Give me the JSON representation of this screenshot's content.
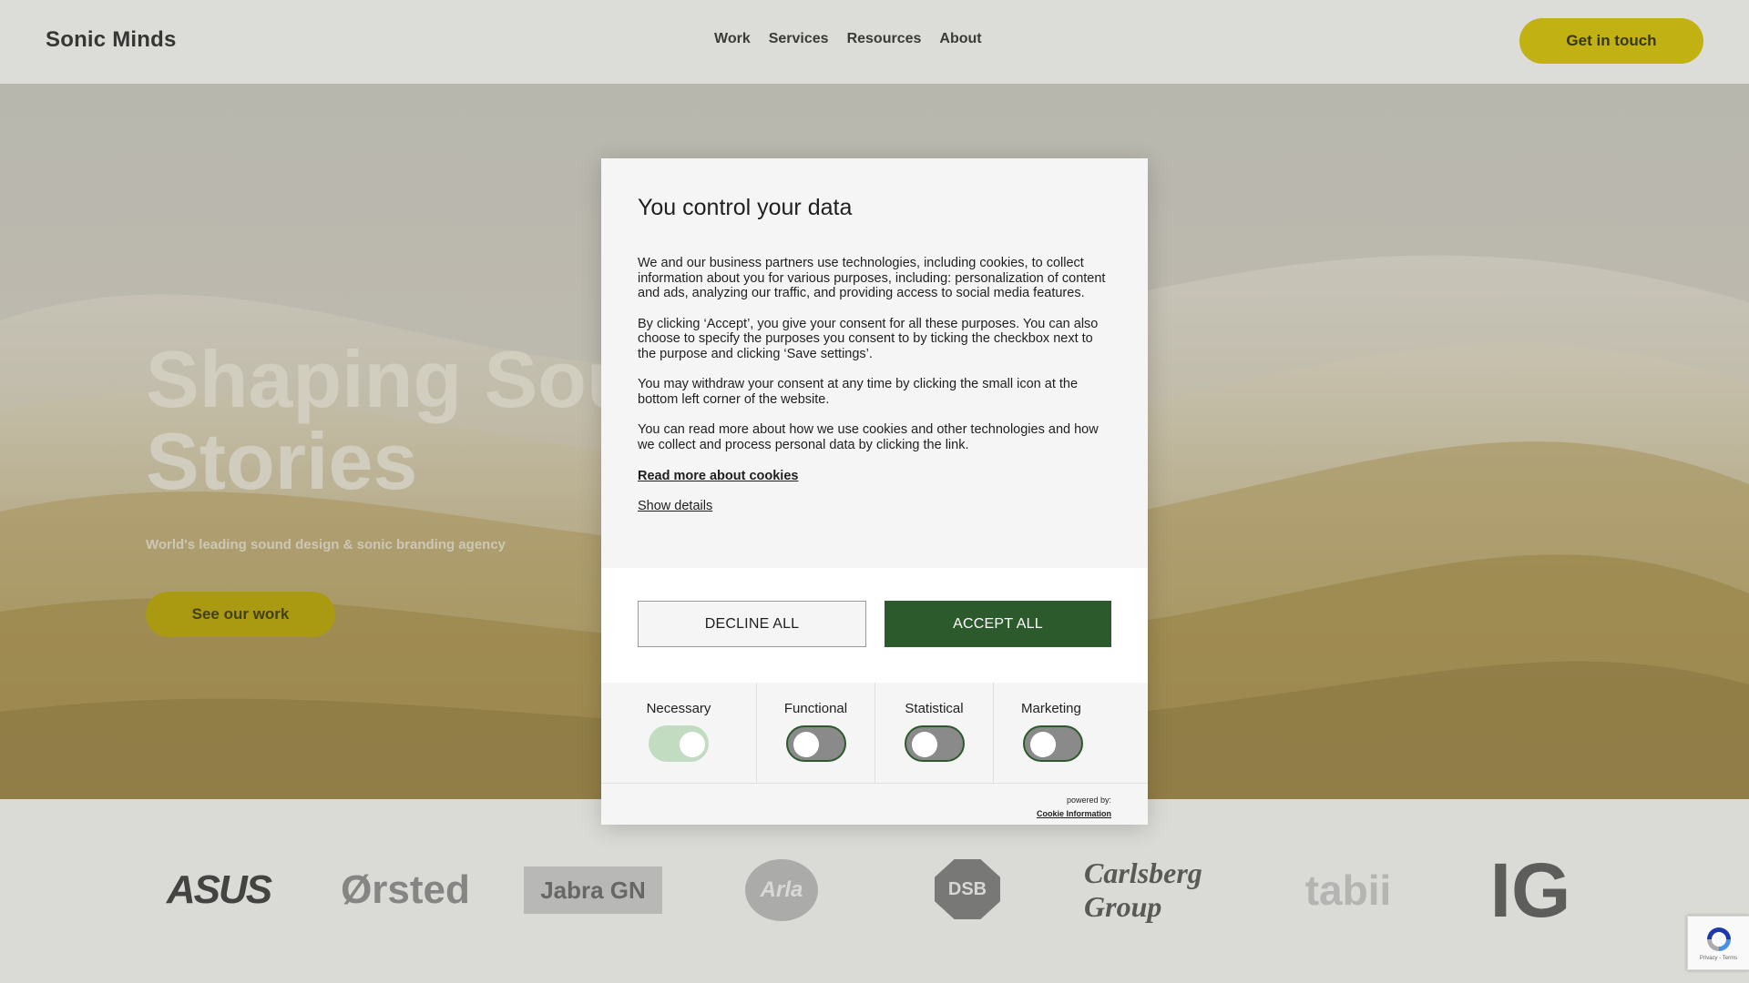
{
  "header": {
    "brand": "Sonic Minds",
    "nav": [
      "Work",
      "Services",
      "Resources",
      "About"
    ],
    "cta": "Get in touch"
  },
  "hero": {
    "title_line1": "Shaping Sou",
    "title_line2": "Stories",
    "subtitle": "World's leading sound design & sonic branding agency",
    "cta": "See our work"
  },
  "logos": [
    "ASUS",
    "Ørsted",
    "Jabra GN",
    "Arla",
    "DSB",
    "Carlsberg Group",
    "tabii",
    "IG"
  ],
  "cookie_modal": {
    "title": "You control your data",
    "paragraphs": [
      "We and our business partners use technologies, including cookies, to collect information about you for various purposes, including: personalization of content and ads, analyzing our traffic, and providing access to social media features.",
      "By clicking ‘Accept’, you give your consent for all these purposes. You can also choose to specify the purposes you consent to by ticking the checkbox next to the purpose and clicking ‘Save settings’.",
      "You may withdraw your consent at any time by clicking the small icon at the bottom left corner of the website.",
      "You can read more about how we use cookies and other technologies and how we collect and process personal data by clicking the link."
    ],
    "read_more": "Read more about cookies",
    "show_details": "Show details",
    "decline": "DECLINE ALL",
    "accept": "ACCEPT ALL",
    "categories": [
      {
        "label": "Necessary",
        "enabled": true
      },
      {
        "label": "Functional",
        "enabled": false
      },
      {
        "label": "Statistical",
        "enabled": false
      },
      {
        "label": "Marketing",
        "enabled": false
      }
    ],
    "powered_by": "powered by:",
    "provider": "Cookie Information"
  },
  "recaptcha": {
    "terms": "Privacy - Terms"
  },
  "colors": {
    "accent_yellow": "#d4c000",
    "accept_green": "#2d5a2d"
  }
}
